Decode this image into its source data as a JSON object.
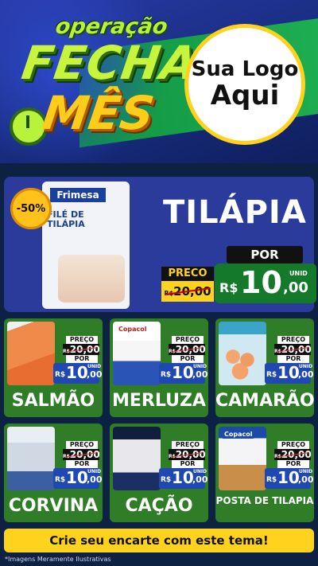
{
  "header": {
    "title_line1": "operação",
    "title_line2": "FECHA",
    "title_line3": "MÊS",
    "logo_line1": "Sua Logo",
    "logo_line2": "Aqui"
  },
  "featured": {
    "discount": "-50%",
    "package_brand": "Frimesa",
    "package_label_line1": "FILÉ DE",
    "package_label_line2": "TILÁPIA",
    "title": "TILÁPIA",
    "preco_label": "PRECO",
    "old_currency": "R$",
    "old_price": "20,00",
    "por_label": "POR",
    "currency": "R$",
    "price_int": "10",
    "price_dec": ",00",
    "unit": "UNID"
  },
  "products": [
    {
      "name": "SALMÃO",
      "preco_label": "PREÇO",
      "old_currency": "R$",
      "old_price": "20,00",
      "por_label": "POR",
      "currency": "R$",
      "price_int": "10",
      "price_dec": ",00",
      "unit": "UNID"
    },
    {
      "name": "MERLUZA",
      "brand": "Copacol",
      "preco_label": "PREÇO",
      "old_currency": "R$",
      "old_price": "20,00",
      "por_label": "POR",
      "currency": "R$",
      "price_int": "10",
      "price_dec": ",00",
      "unit": "UNID"
    },
    {
      "name": "CAMARÃO",
      "preco_label": "PREÇO",
      "old_currency": "R$",
      "old_price": "20,00",
      "por_label": "POR",
      "currency": "R$",
      "price_int": "10",
      "price_dec": ",00",
      "unit": "UNID"
    },
    {
      "name": "CORVINA",
      "preco_label": "PREÇO",
      "old_currency": "R$",
      "old_price": "20,00",
      "por_label": "POR",
      "currency": "R$",
      "price_int": "10",
      "price_dec": ",00",
      "unit": "UNID"
    },
    {
      "name": "CAÇÃO",
      "preco_label": "PREÇO",
      "old_currency": "R$",
      "old_price": "20,00",
      "por_label": "POR",
      "currency": "R$",
      "price_int": "10",
      "price_dec": ",00",
      "unit": "UNID"
    },
    {
      "name": "POSTA DE TILAPIA",
      "brand": "Copacol",
      "preco_label": "PREÇO",
      "old_currency": "R$",
      "old_price": "20,00",
      "por_label": "POR",
      "currency": "R$",
      "price_int": "10",
      "price_dec": ",00",
      "unit": "UNID"
    }
  ],
  "cta": "Crie seu encarte com este tema!",
  "footer": "*Imagens Meramente Ilustrativas"
}
